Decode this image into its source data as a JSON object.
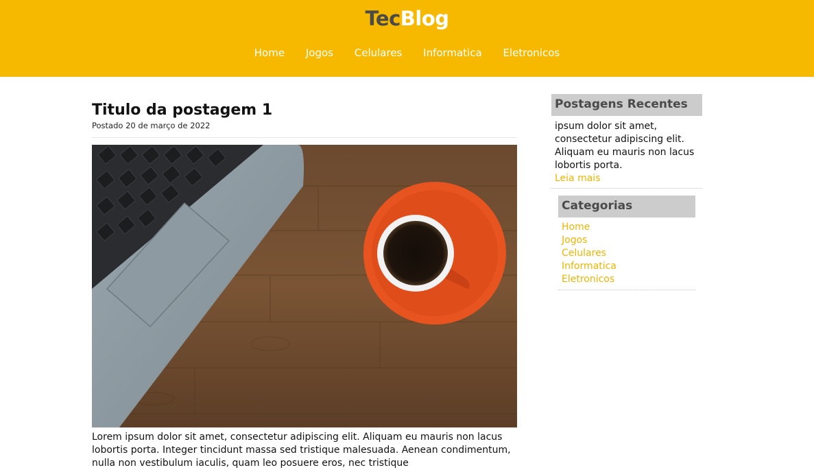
{
  "header": {
    "logo_part1": "Tec",
    "logo_part2": "Blog",
    "nav": [
      "Home",
      "Jogos",
      "Celulares",
      "Informatica",
      "Eletronicos"
    ]
  },
  "post": {
    "title": "Titulo da postagem 1",
    "date": "Postado 20 de março de 2022",
    "body": "Lorem ipsum dolor sit amet, consectetur adipiscing elit. Aliquam eu mauris non lacus lobortis porta. Integer tincidunt massa sed tristique malesuada. Aenean condimentum, nulla non vestibulum iaculis, quam leo posuere eros, nec tristique"
  },
  "sidebar": {
    "recent_title": "Postagens Recentes",
    "recent_text": "ipsum dolor sit amet, consectetur adipiscing elit. Aliquam eu mauris non lacus lobortis porta.",
    "read_more": "Leia mais",
    "categories_title": "Categorias",
    "categories": [
      "Home",
      "Jogos",
      "Celulares",
      "Informatica",
      "Eletronicos"
    ]
  },
  "colors": {
    "accent": "#f7b900",
    "link": "#f0b400",
    "widget_bg": "#cccccc"
  }
}
